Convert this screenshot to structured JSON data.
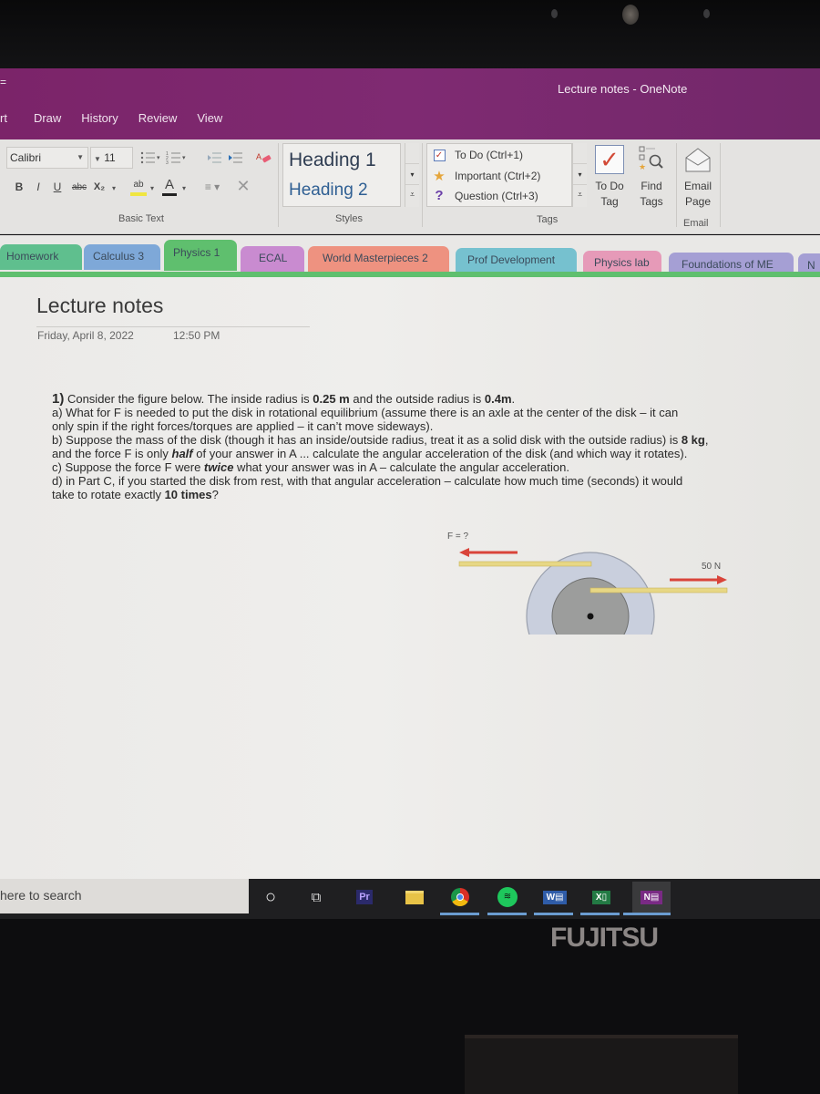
{
  "window": {
    "title": "Lecture notes  -  OneNote",
    "quick_access": "="
  },
  "menu": {
    "tabs": [
      "rt",
      "Draw",
      "History",
      "Review",
      "View"
    ]
  },
  "ribbon": {
    "basic_text": {
      "font_name": "Calibri",
      "font_size": "11",
      "group_label": "Basic Text",
      "bold": "B",
      "italic": "I",
      "underline": "U",
      "strikethrough": "abc",
      "subscript": "X₂",
      "highlight": "ab",
      "font_color": "A",
      "clear": "✕"
    },
    "styles": {
      "items": [
        "Heading 1",
        "Heading 2"
      ],
      "group_label": "Styles"
    },
    "tags": {
      "items": [
        {
          "icon": "checkbox-icon",
          "label": "To Do (Ctrl+1)"
        },
        {
          "icon": "star-icon",
          "label": "Important (Ctrl+2)"
        },
        {
          "icon": "question-icon",
          "label": "Question (Ctrl+3)"
        }
      ],
      "todo_tag_label": [
        "To Do",
        "Tag"
      ],
      "find_tags_label": [
        "Find",
        "Tags"
      ],
      "group_label": "Tags"
    },
    "email": {
      "button_label": [
        "Email",
        "Page"
      ],
      "group_label": "Email"
    }
  },
  "sections": [
    {
      "label": "Homework",
      "color": "#5fbf8e"
    },
    {
      "label": "Calculus 3",
      "color": "#7ea8d8"
    },
    {
      "label": "Physics 1",
      "color": "#5fbf6e",
      "active": true
    },
    {
      "label": "ECAL",
      "color": "#c98bd0"
    },
    {
      "label": "World Masterpieces 2",
      "color": "#ee9280"
    },
    {
      "label": "Prof Development",
      "color": "#76c1cf"
    },
    {
      "label": "Physics lab",
      "color": "#e69ab8"
    },
    {
      "label": "Foundations of ME",
      "color": "#a59fd4"
    },
    {
      "label": "N",
      "color": "#a59fd4"
    }
  ],
  "page": {
    "title": "Lecture notes",
    "date": "Friday, April 8, 2022",
    "time": "12:50 PM",
    "problem": {
      "number": "1)",
      "intro_a": " Consider the figure below. The inside radius is ",
      "inner_radius": "0.25 m",
      "intro_b": " and the outside radius is ",
      "outer_radius": "0.4m",
      "intro_c": ".",
      "part_a_1": "a) What for F is needed to put the disk in rotational equilibrium (assume there is an axle at the center of the disk – it can",
      "part_a_2": "only spin if the right forces/torques are applied – it can’t move sideways).",
      "part_b_1a": "b) Suppose the mass of the disk (though it has an inside/outside radius, treat it as a solid disk with the outside radius) is ",
      "mass": "8 kg",
      "part_b_1b": ",",
      "part_b_2a": "and the force F is only ",
      "half": "half",
      "part_b_2b": " of your answer in A ... calculate the angular acceleration of the disk (and which way it rotates).",
      "part_c_a": "c) Suppose the force F were ",
      "twice": "twice",
      "part_c_b": " what your answer was in A – calculate the angular acceleration.",
      "part_d_1": "d) in Part C, if you started the disk from rest, with that angular acceleration – calculate how much time (seconds) it would",
      "part_d_2a": "take to rotate exactly ",
      "rotations": "10 times",
      "part_d_2b": "?"
    },
    "figure": {
      "left_force_label": "F = ?",
      "right_force_label": "50 N"
    }
  },
  "taskbar": {
    "search_placeholder": "here to search",
    "apps": [
      {
        "name": "cortana",
        "glyph": "○"
      },
      {
        "name": "task-view",
        "glyph": "⧉"
      },
      {
        "name": "premiere-pro",
        "glyph": "Pr"
      },
      {
        "name": "file-explorer",
        "glyph": ""
      },
      {
        "name": "chrome",
        "glyph": ""
      },
      {
        "name": "spotify",
        "glyph": ""
      },
      {
        "name": "word",
        "glyph": "W"
      },
      {
        "name": "excel",
        "glyph": "X"
      },
      {
        "name": "onenote",
        "glyph": "N"
      }
    ]
  },
  "device": {
    "brand": "FUJITSU"
  }
}
